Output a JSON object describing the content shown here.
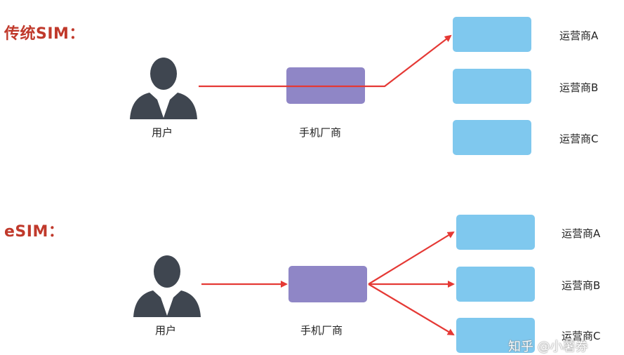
{
  "traditional": {
    "title": "传统SIM：",
    "user_label": "用户",
    "vendor_label": "手机厂商",
    "carriers": [
      "运营商A",
      "运营商B",
      "运营商C"
    ]
  },
  "esim": {
    "title": "eSIM：",
    "user_label": "用户",
    "vendor_label": "手机厂商",
    "carriers": [
      "运营商A",
      "运营商B",
      "运营商C"
    ]
  },
  "watermark": "知乎 @小薯券",
  "colors": {
    "title": "#c0392b",
    "arrow": "#e53935",
    "vendor_box": "#8f86c6",
    "carrier_box": "#7fc8ee",
    "user_icon": "#3f4650"
  },
  "icons": {
    "user": "user-silhouette-icon"
  }
}
